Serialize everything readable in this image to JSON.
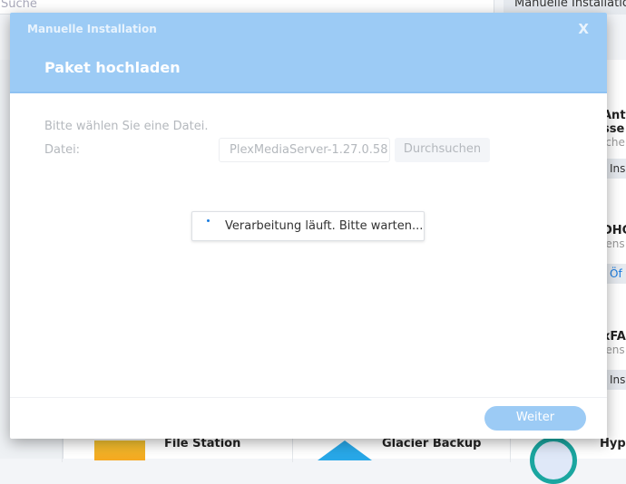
{
  "background": {
    "search_placeholder": "Suche",
    "manual_install_button": "Manuelle Installation",
    "side_apps": [
      {
        "title1": "Anti",
        "title2": "sse",
        "sub": "iche",
        "button": "Ins"
      },
      {
        "title1": "DHC",
        "sub": "iens",
        "button": "Öf"
      },
      {
        "title1": "xFA",
        "sub": "iens",
        "button": "Ins"
      }
    ],
    "bottom_apps": [
      "File Station",
      "Glacier Backup",
      "Hyp"
    ]
  },
  "dialog": {
    "window_title": "Manuelle Installation",
    "close_label": "X",
    "step_title": "Paket hochladen",
    "hint": "Bitte wählen Sie eine Datei.",
    "file_label": "Datei:",
    "file_value": "PlexMediaServer-1.27.0.58",
    "browse_label": "Durchsuchen",
    "loading_text": "Verarbeitung läuft. Bitte warten...",
    "next_label": "Weiter"
  },
  "colors": {
    "header": "#9ccbf5",
    "accent": "#1a7ce0"
  }
}
